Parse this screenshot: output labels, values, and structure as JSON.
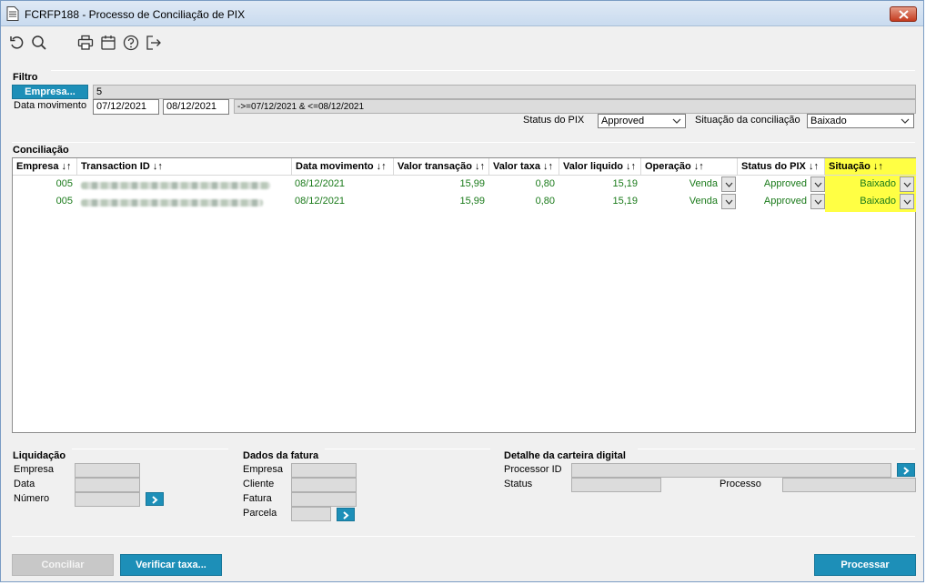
{
  "window": {
    "title": "FCRFP188 - Processo de Conciliação de PIX"
  },
  "toolbar": {
    "icons": [
      "undo-icon",
      "search-icon",
      "print-icon",
      "calendar-icon",
      "help-icon",
      "exit-icon"
    ]
  },
  "filtro": {
    "title": "Filtro",
    "empresa_button": "Empresa...",
    "empresa_value": "5",
    "data_movimento_label": "Data movimento",
    "date_from": "07/12/2021",
    "date_to": "08/12/2021",
    "date_expression": "->=07/12/2021 & <=08/12/2021",
    "status_pix_label": "Status do PIX",
    "status_pix_value": "Approved",
    "situacao_label": "Situação da conciliação",
    "situacao_value": "Baixado"
  },
  "conciliacao": {
    "title": "Conciliação",
    "columns": [
      "Empresa ↓↑",
      "Transaction ID ↓↑",
      "Data movimento ↓↑",
      "Valor transação ↓↑",
      "Valor taxa ↓↑",
      "Valor liquido ↓↑",
      "Operação ↓↑",
      "Status do PIX ↓↑",
      "Situação ↓↑"
    ],
    "rows": [
      {
        "empresa": "005",
        "transaction_id": "",
        "data": "08/12/2021",
        "valor_transacao": "15,99",
        "valor_taxa": "0,80",
        "valor_liquido": "15,19",
        "operacao": "Venda",
        "status_pix": "Approved",
        "situacao": "Baixado"
      },
      {
        "empresa": "005",
        "transaction_id": "",
        "data": "08/12/2021",
        "valor_transacao": "15,99",
        "valor_taxa": "0,80",
        "valor_liquido": "15,19",
        "operacao": "Venda",
        "status_pix": "Approved",
        "situacao": "Baixado"
      }
    ]
  },
  "liquidacao": {
    "title": "Liquidação",
    "labels": [
      "Empresa",
      "Data",
      "Número"
    ]
  },
  "dados_fatura": {
    "title": "Dados da fatura",
    "labels": [
      "Empresa",
      "Cliente",
      "Fatura",
      "Parcela"
    ]
  },
  "carteira": {
    "title": "Detalhe da carteira digital",
    "processor_label": "Processor ID",
    "status_label": "Status",
    "processo_label": "Processo"
  },
  "footer": {
    "conciliar_label": "Conciliar",
    "verificar_label": "Verificar taxa...",
    "processar_label": "Processar"
  },
  "colors": {
    "accent": "#1d8fb8",
    "data_text": "#1a7a1a",
    "highlight": "#ffff44"
  }
}
